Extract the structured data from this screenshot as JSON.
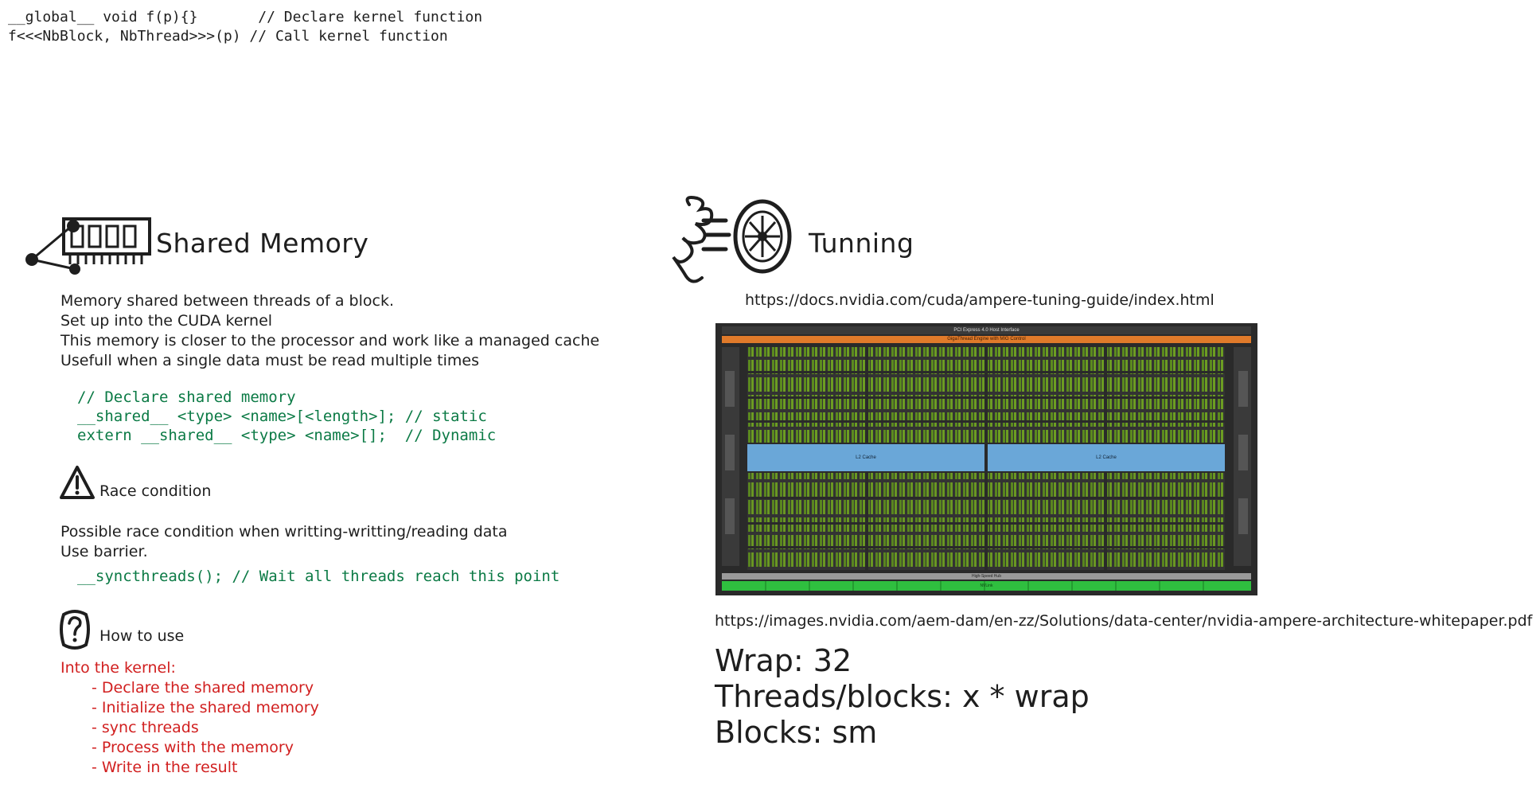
{
  "code_top": {
    "line1": "__global__ void f(p){}       // Declare kernel function",
    "line2": "f<<<NbBlock, NbThread>>>(p) // Call kernel function"
  },
  "shared_memory": {
    "title": "Shared Memory",
    "desc": [
      "Memory shared between threads of a block.",
      "Set up into the CUDA kernel",
      "This memory is closer to the processor and work like a managed cache",
      "Usefull when a single data must be read multiple times"
    ],
    "code": [
      "// Declare shared memory",
      "__shared__ <type> <name>[<length>]; // static",
      "extern __shared__ <type> <name>[];  // Dynamic"
    ]
  },
  "race_condition": {
    "title": "Race condition",
    "desc": [
      "Possible race condition when writting-writting/reading data",
      "Use barrier."
    ],
    "code": "__syncthreads(); // Wait all threads reach this point"
  },
  "how_to_use": {
    "title": "How to use",
    "intro": "Into the kernel:",
    "steps": [
      "- Declare the shared memory",
      "- Initialize the shared memory",
      "- sync threads",
      "- Process with the memory",
      "- Write in the result"
    ]
  },
  "tuning": {
    "title": "Tunning",
    "link1": "https://docs.nvidia.com/cuda/ampere-tuning-guide/index.html",
    "link2": "https://images.nvidia.com/aem-dam/en-zz/Solutions/data-center/nvidia-ampere-architecture-whitepaper.pdf",
    "notes": [
      "Wrap: 32",
      "Threads/blocks: x * wrap",
      "Blocks: sm"
    ]
  },
  "chip": {
    "header": "PCI Express 4.0 Host Interface",
    "subheader": "GigaThread Engine with MIG Control",
    "l2_left": "L2 Cache",
    "l2_right": "L2 Cache",
    "hub": "High-Speed Hub",
    "nvlink": "NVLink",
    "colors": {
      "header": "#e07a2a",
      "l2": "#6aa7d8",
      "sm": "#5b8a1e",
      "nvlink": "#2fbf3f",
      "frame": "#2a2a2a"
    }
  },
  "icons": [
    "ram-chip-icon",
    "warning-icon",
    "question-icon",
    "turbo-fan-icon"
  ]
}
